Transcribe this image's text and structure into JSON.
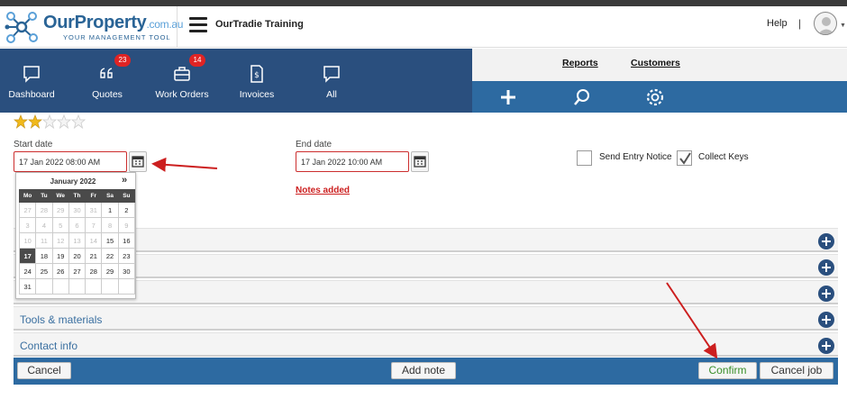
{
  "header": {
    "brand_main": "OurProperty",
    "brand_domain": ".com.au",
    "brand_tagline": "YOUR MANAGEMENT TOOL",
    "company": "OurTradie Training",
    "help": "Help",
    "separator": "|"
  },
  "nav": {
    "items": [
      {
        "label": "Dashboard",
        "icon": "chat-bubble-icon"
      },
      {
        "label": "Quotes",
        "icon": "quote-icon",
        "badge": "23"
      },
      {
        "label": "Work Orders",
        "icon": "briefcase-icon",
        "badge": "14"
      },
      {
        "label": "Invoices",
        "icon": "invoice-icon"
      },
      {
        "label": "All",
        "icon": "chat-bubble-icon"
      }
    ]
  },
  "top_links": {
    "reports": "Reports",
    "customers": "Customers"
  },
  "actions": [
    "plus-icon",
    "search-icon",
    "gear-icon"
  ],
  "rating": {
    "value": 2,
    "max": 5
  },
  "start_date": {
    "label": "Start date",
    "value": "17 Jan 2022 08:00 AM"
  },
  "end_date": {
    "label": "End date",
    "value": "17 Jan 2022 10:00 AM"
  },
  "checks": {
    "entry_notice": {
      "label": "Send Entry Notice",
      "checked": false
    },
    "collect_keys": {
      "label": "Collect Keys",
      "checked": true
    }
  },
  "notes_link": "Notes added",
  "calendar": {
    "title": "January 2022",
    "next": "»",
    "weekdays": [
      "Mo",
      "Tu",
      "We",
      "Th",
      "Fr",
      "Sa",
      "Su"
    ],
    "weeks": [
      [
        "27",
        "28",
        "29",
        "30",
        "31",
        "1",
        "2"
      ],
      [
        "3",
        "4",
        "5",
        "6",
        "7",
        "8",
        "9"
      ],
      [
        "10",
        "11",
        "12",
        "13",
        "14",
        "15",
        "16"
      ],
      [
        "17",
        "18",
        "19",
        "20",
        "21",
        "22",
        "23"
      ],
      [
        "24",
        "25",
        "26",
        "27",
        "28",
        "29",
        "30"
      ],
      [
        "31",
        "",
        "",
        "",
        "",
        "",
        ""
      ]
    ],
    "selected": "17"
  },
  "sections": [
    "",
    "",
    "",
    "Tools & materials",
    "Contact info"
  ],
  "footer": {
    "cancel": "Cancel",
    "add_note": "Add note",
    "confirm": "Confirm",
    "cancel_job": "Cancel job"
  },
  "colors": {
    "nav_bg": "#2a4f7e",
    "action_bg": "#2d6aa1",
    "badge": "#e02424",
    "error_border": "#cc2e2e",
    "confirm_text": "#3a8f2a"
  }
}
